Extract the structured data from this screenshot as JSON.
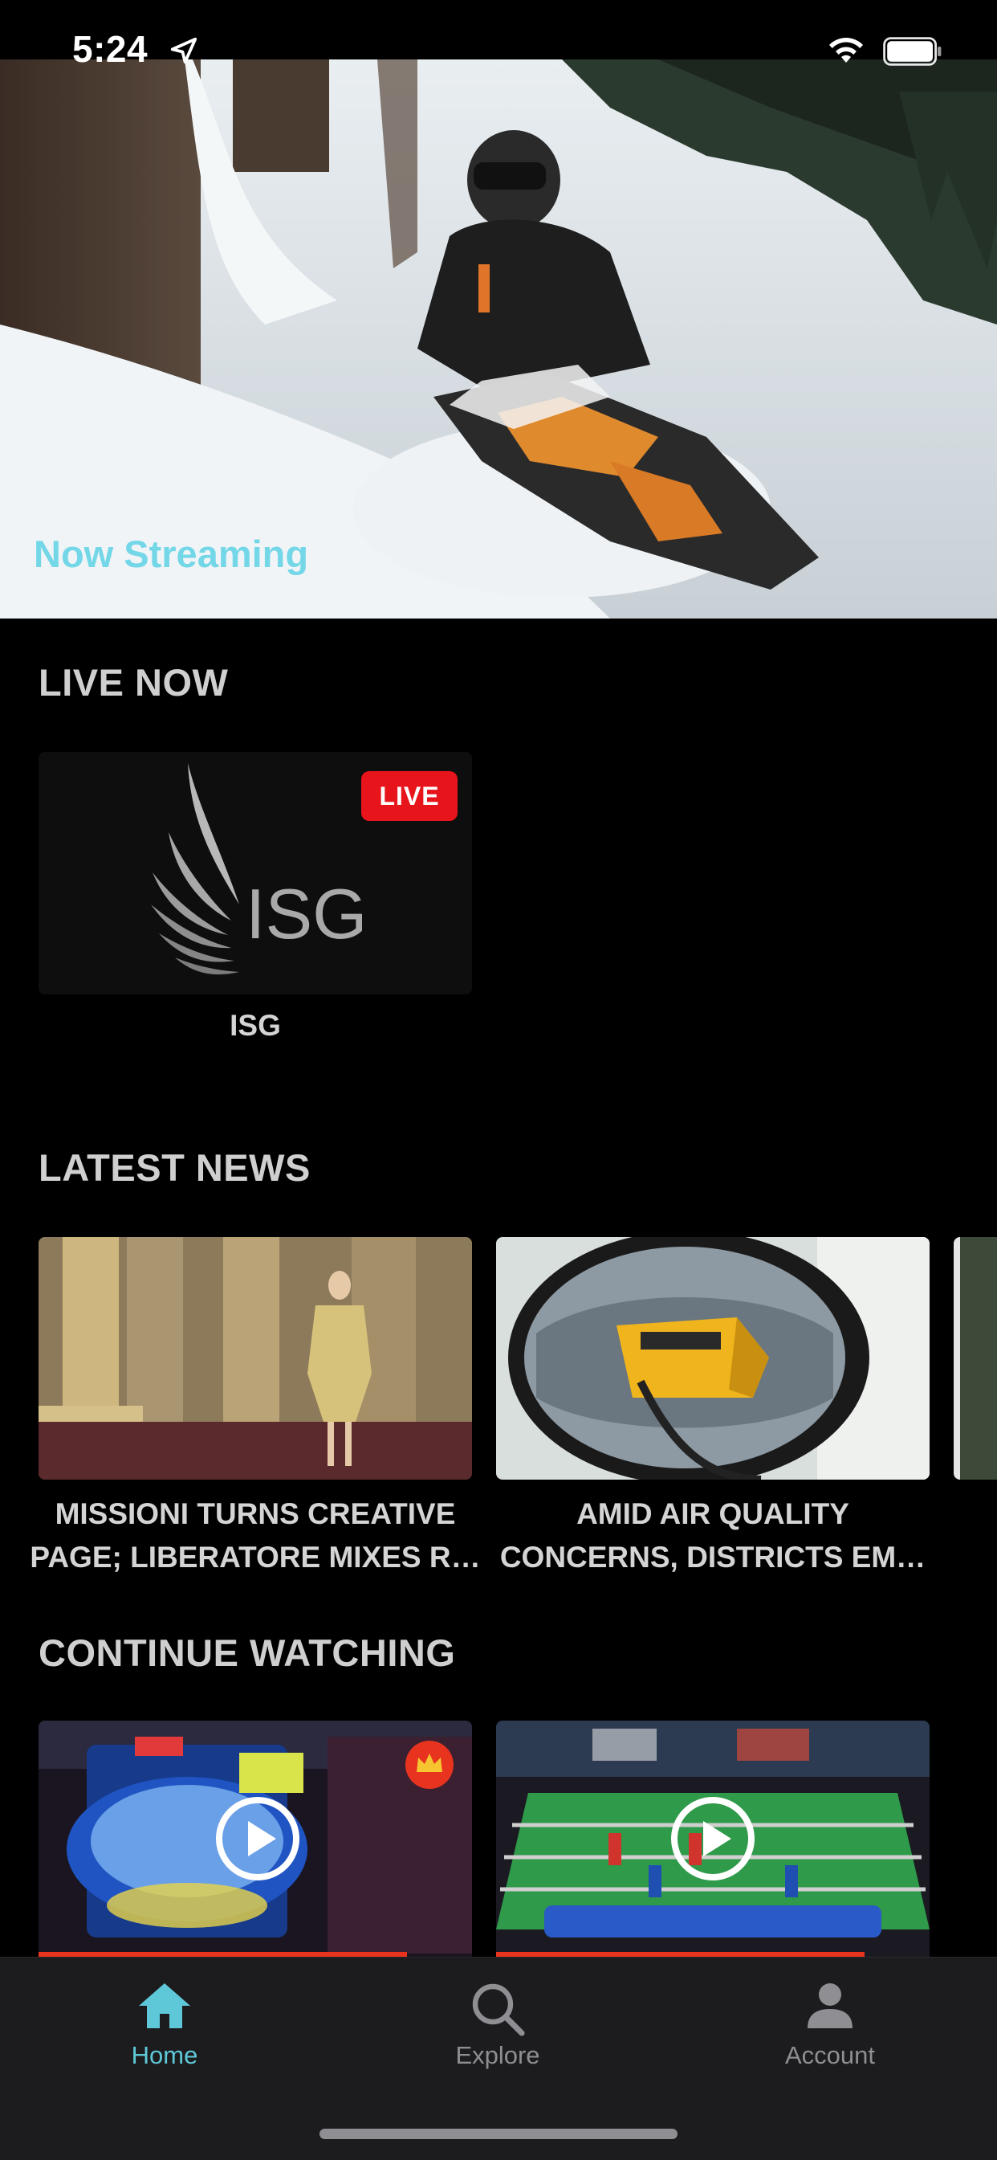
{
  "status_bar": {
    "time": "5:24"
  },
  "hero": {
    "label": "Now Streaming"
  },
  "live_now": {
    "title": "LIVE NOW",
    "card": {
      "badge": "LIVE",
      "logo_text": "ISG",
      "caption": "ISG"
    }
  },
  "latest_news": {
    "title": "LATEST NEWS",
    "items": [
      {
        "title": "MISSIONI TURNS CREATIVE PAGE; LIBERATORE MIXES R…"
      },
      {
        "title": "AMID AIR QUALITY CONCERNS, DISTRICTS EM…"
      }
    ]
  },
  "continue_watching": {
    "title": "CONTINUE WATCHING",
    "items": [
      {
        "progress": 0.85,
        "premium": true
      },
      {
        "progress": 0.85,
        "premium": false
      }
    ]
  },
  "tab_bar": {
    "active_color": "#5fc8d8",
    "inactive_color": "#8e8e93",
    "tabs": [
      {
        "label": "Home",
        "icon": "home-icon",
        "active": true
      },
      {
        "label": "Explore",
        "icon": "search-icon",
        "active": false
      },
      {
        "label": "Account",
        "icon": "account-icon",
        "active": false
      }
    ]
  },
  "colors": {
    "live_badge": "#e8141c",
    "accent": "#5fd3e6",
    "progress": "#e8331f"
  }
}
